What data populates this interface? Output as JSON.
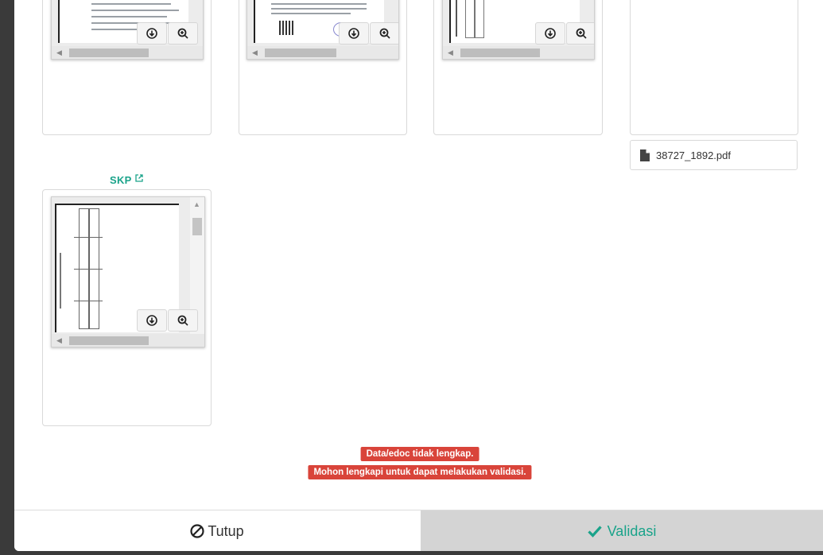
{
  "documents": {
    "skp_title": "SKP",
    "file_name": "38727_1892.pdf"
  },
  "alerts": {
    "line1": "Data/edoc tidak lengkap.",
    "line2": "Mohon lengkapi untuk dapat melakukan validasi."
  },
  "footer": {
    "close_label": "Tutup",
    "validate_label": "Validasi"
  },
  "icons": {
    "download": "download-icon",
    "zoom": "zoom-in-icon",
    "external": "external-link-icon",
    "file": "file-icon",
    "ban": "ban-icon",
    "check": "check-icon"
  },
  "colors": {
    "accent": "#1aa38a",
    "alert": "#d9443a",
    "validate_bg": "#d4d4d4"
  }
}
